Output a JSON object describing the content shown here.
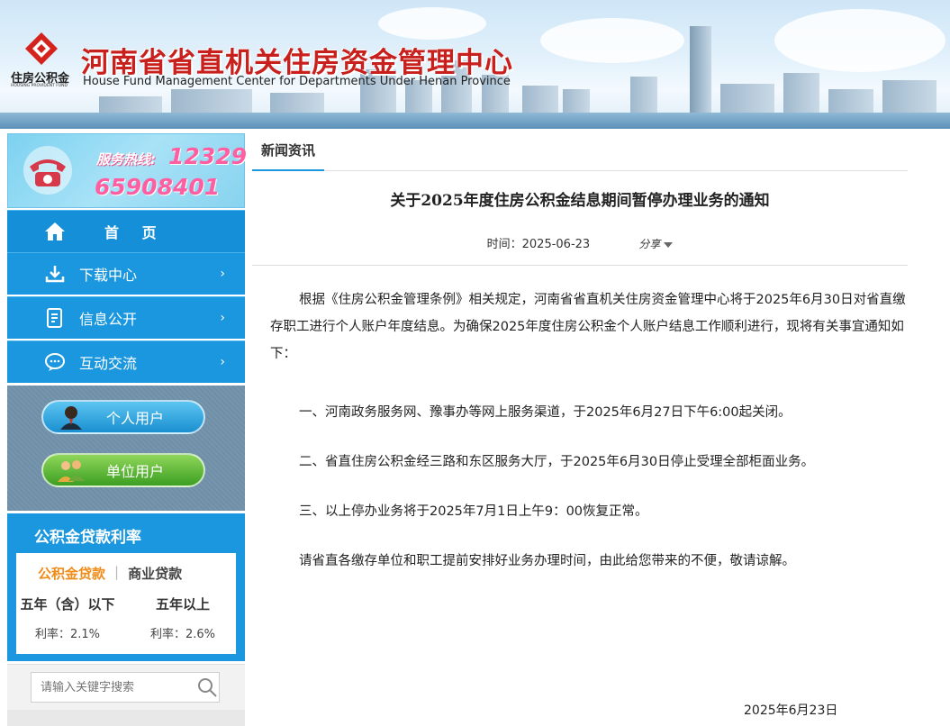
{
  "header": {
    "logo_cn": "住房公积金",
    "logo_en": "HOUSING PROVIDENT FUND",
    "title": "河南省省直机关住房资金管理中心",
    "subtitle": "House Fund Management Center for Departments Under Henan Province"
  },
  "hotline": {
    "label": "服务热线:",
    "number1": "12329",
    "number2": "65908401"
  },
  "nav": {
    "home": "首 页",
    "items": [
      {
        "label": "下载中心",
        "icon": "download-icon"
      },
      {
        "label": "信息公开",
        "icon": "document-icon"
      },
      {
        "label": "互动交流",
        "icon": "chat-icon"
      }
    ],
    "arrow": "›"
  },
  "users": {
    "personal": "个人用户",
    "unit": "单位用户"
  },
  "rates": {
    "title": "公积金贷款利率",
    "tabs": [
      "公积金贷款",
      "商业贷款"
    ],
    "separator": "|",
    "cols": [
      {
        "head": "五年（含）以下",
        "value": "利率：2.1%"
      },
      {
        "head": "五年以上",
        "value": "利率：2.6%"
      }
    ]
  },
  "search": {
    "placeholder": "请输入关键字搜索"
  },
  "article": {
    "crumb": "新闻资讯",
    "title": "关于2025年度住房公积金结息期间暂停办理业务的通知",
    "time_label": "时间：2025-06-23",
    "share": "分享",
    "paragraphs": [
      "根据《住房公积金管理条例》相关规定，河南省省直机关住房资金管理中心将于2025年6月30日对省直缴存职工进行个人账户年度结息。为确保2025年度住房公积金个人账户结息工作顺利进行，现将有关事宜通知如下：",
      "一、河南政务服务网、豫事办等网上服务渠道，于2025年6月27日下午6:00起关闭。",
      "二、省直住房公积金经三路和东区服务大厅，于2025年6月30日停止受理全部柜面业务。",
      "三、以上停办业务将于2025年7月1日上午9：00恢复正常。",
      "请省直各缴存单位和职工提前安排好业务办理时间，由此给您带来的不便，敬请谅解。"
    ],
    "date": "2025年6月23日"
  }
}
